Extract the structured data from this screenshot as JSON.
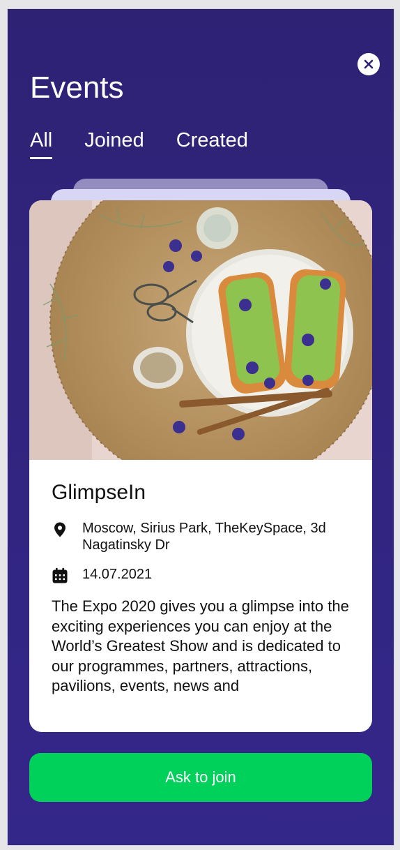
{
  "header": {
    "title": "Events",
    "close_icon": "close-icon"
  },
  "tabs": [
    {
      "label": "All",
      "active": true
    },
    {
      "label": "Joined",
      "active": false
    },
    {
      "label": "Created",
      "active": false
    }
  ],
  "event": {
    "image_icon": "food-photo",
    "name": "GlimpseIn",
    "location": "Moscow, Sirius Park, TheKeySpace, 3d Nagatinsky Dr",
    "date": "14.07.2021",
    "description": "The Expo 2020 gives you a glimpse into the exciting experiences you can enjoy at the World’s Greatest Show and is dedicated to our programmes, partners, attractions, pavilions, events, news and"
  },
  "action": {
    "join_label": "Ask to join"
  },
  "colors": {
    "background": "#2e2275",
    "accent": "#00d15a",
    "card": "#ffffff"
  }
}
